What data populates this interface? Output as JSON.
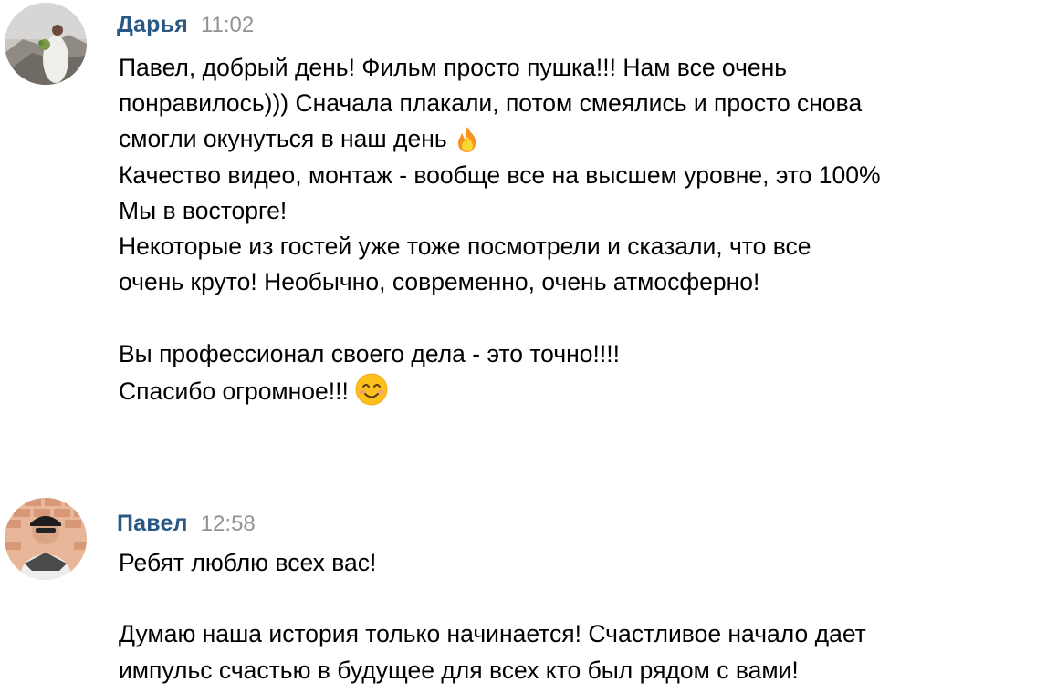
{
  "messages": [
    {
      "author": "Дарья",
      "time": "11:02",
      "lines": [
        "Павел, добрый день! Фильм просто пушка!!! Нам все очень",
        "понравилось))) Сначала плакали, потом смеялись и просто снова",
        "смогли окунуться в наш день",
        "Качество видео, монтаж - вообще все на высшем уровне, это 100%",
        "Мы в восторге!",
        "Некоторые из гостей уже тоже посмотрели и сказали, что все",
        "очень круто! Необычно, современно, очень атмосферно!",
        "",
        "Вы профессионал своего дела - это точно!!!!",
        "Спасибо огромное!!!"
      ],
      "emojis": {
        "line_3": "fire-emoji",
        "line_10": "smiling-face-emoji"
      }
    },
    {
      "author": "Павел",
      "time": "12:58",
      "lines": [
        "Ребят люблю всех вас!",
        "",
        "Думаю наша история только начинается! Счастливое начало дает",
        "импульс счастью в будущее для всех кто был рядом с вами!"
      ]
    }
  ],
  "colors": {
    "author_name": "#2a5885",
    "timestamp": "#939393",
    "text": "#000000",
    "background": "#ffffff"
  }
}
